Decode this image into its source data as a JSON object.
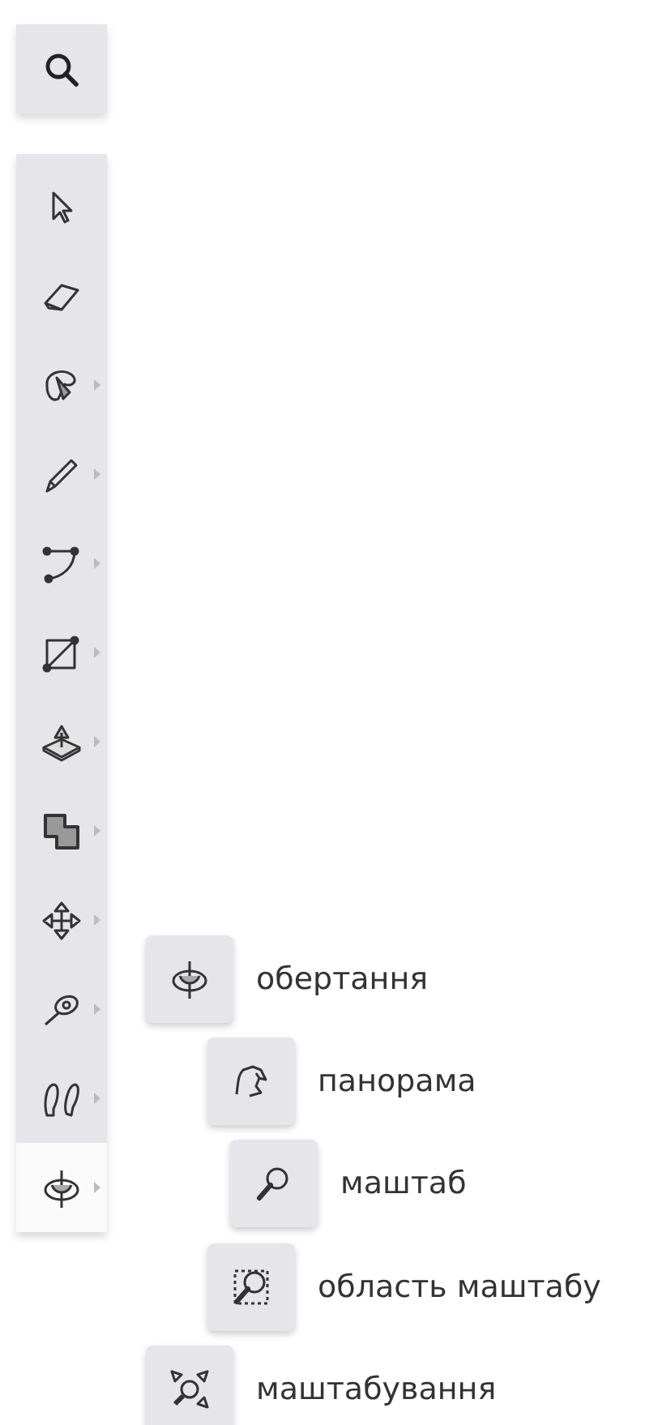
{
  "search_button": {
    "kind": "search"
  },
  "tools": [
    {
      "kind": "select",
      "submenu": false,
      "selected": false
    },
    {
      "kind": "eraser",
      "submenu": false,
      "selected": false
    },
    {
      "kind": "paint",
      "submenu": true,
      "selected": false
    },
    {
      "kind": "pencil",
      "submenu": true,
      "selected": false
    },
    {
      "kind": "arc",
      "submenu": true,
      "selected": false
    },
    {
      "kind": "rectangle",
      "submenu": true,
      "selected": false
    },
    {
      "kind": "pushpull",
      "submenu": true,
      "selected": false
    },
    {
      "kind": "offset",
      "submenu": true,
      "selected": false
    },
    {
      "kind": "move",
      "submenu": true,
      "selected": false
    },
    {
      "kind": "tape",
      "submenu": true,
      "selected": false
    },
    {
      "kind": "footprints",
      "submenu": true,
      "selected": false
    },
    {
      "kind": "orbit",
      "submenu": true,
      "selected": true
    }
  ],
  "flyout": [
    {
      "kind": "orbit",
      "label": "обертання"
    },
    {
      "kind": "pan",
      "label": "панорама"
    },
    {
      "kind": "zoom",
      "label": "маштаб"
    },
    {
      "kind": "zoomwindow",
      "label": "область маштабу"
    },
    {
      "kind": "extents",
      "label": "маштабування"
    }
  ]
}
